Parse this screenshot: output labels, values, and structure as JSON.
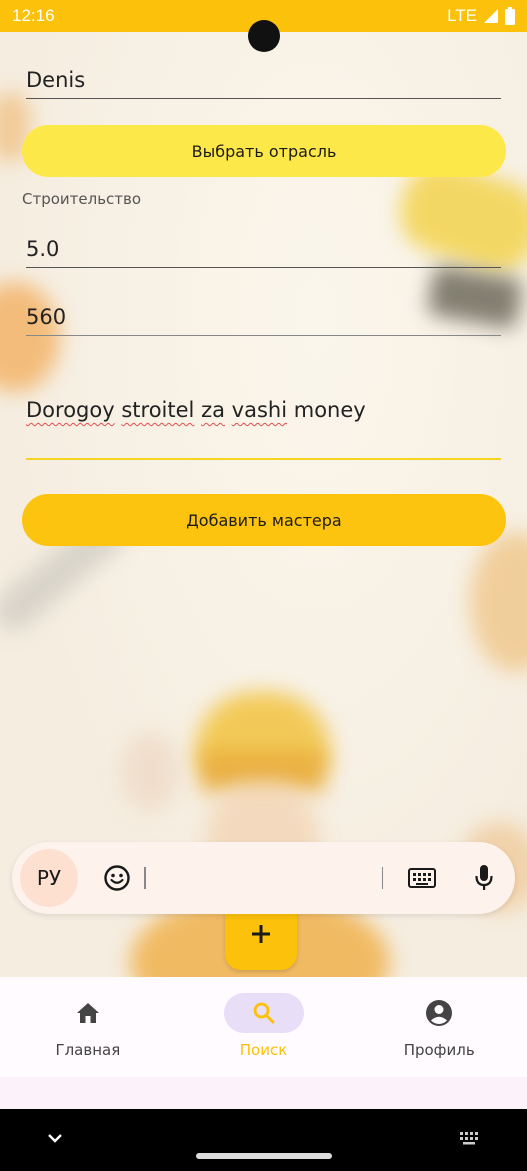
{
  "status_bar": {
    "time": "12:16",
    "network": "LTE"
  },
  "form": {
    "name_value": "Denis",
    "select_industry_button": "Выбрать отрасль",
    "selected_industry": "Строительство",
    "rating_value": "5.0",
    "price_value": "560",
    "description_words": [
      "Dorogoy",
      "stroitel",
      "za",
      "vashi",
      "money"
    ],
    "add_master_button": "Добавить мастера"
  },
  "keyboard_bar": {
    "language": "РУ"
  },
  "fab": {
    "icon": "plus-icon"
  },
  "bottom_nav": {
    "items": [
      {
        "label": "Главная",
        "icon": "home-icon",
        "active": false
      },
      {
        "label": "Поиск",
        "icon": "search-icon",
        "active": true
      },
      {
        "label": "Профиль",
        "icon": "account-circle-icon",
        "active": false
      }
    ]
  },
  "colors": {
    "accent": "#fcc10a",
    "button_light": "#fde84a",
    "nav_active_bg": "#e8def7"
  }
}
